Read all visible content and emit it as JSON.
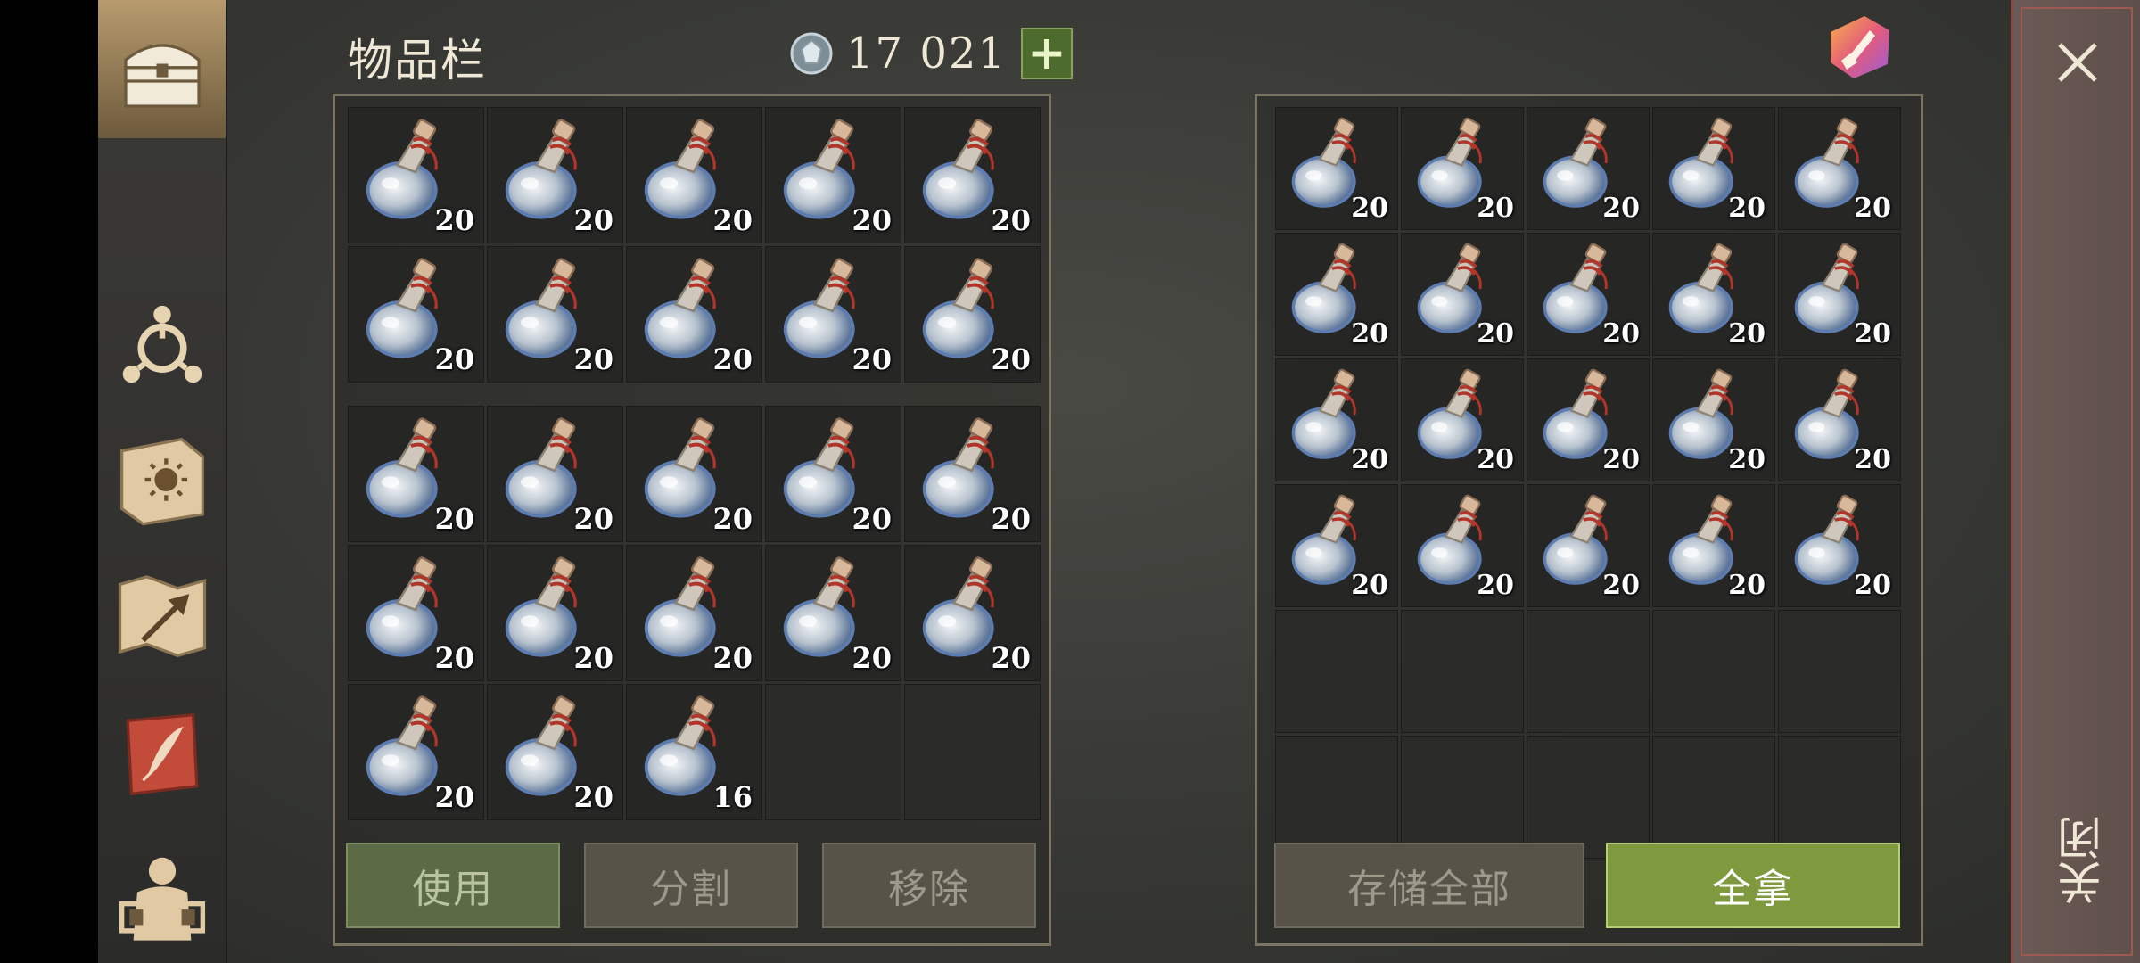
{
  "header": {
    "title": "物品栏",
    "currency_value": "17 021",
    "plus_label": "+"
  },
  "sidebar": {
    "items": [
      {
        "name": "inventory-chest-icon",
        "active": true
      },
      {
        "name": "skills-icon"
      },
      {
        "name": "journal-icon"
      },
      {
        "name": "map-build-icon"
      },
      {
        "name": "quest-scroll-icon"
      },
      {
        "name": "character-icon"
      }
    ]
  },
  "inventory": {
    "grid_top": [
      "20",
      "20",
      "20",
      "20",
      "20",
      "20",
      "20",
      "20",
      "20",
      "20"
    ],
    "grid_bottom": [
      "20",
      "20",
      "20",
      "20",
      "20",
      "20",
      "20",
      "20",
      "20",
      "20",
      "20",
      "20",
      "16",
      "",
      ""
    ]
  },
  "storage": {
    "slots": [
      "20",
      "20",
      "20",
      "20",
      "20",
      "20",
      "20",
      "20",
      "20",
      "20",
      "20",
      "20",
      "20",
      "20",
      "20",
      "20",
      "20",
      "20",
      "20",
      "20",
      "",
      "",
      "",
      "",
      "",
      "",
      "",
      "",
      "",
      ""
    ]
  },
  "buttons": {
    "use": "使用",
    "split": "分割",
    "remove": "移除",
    "store_all": "存储全部",
    "take_all": "全拿"
  },
  "close": {
    "label": "关闭"
  },
  "colors": {
    "accent_green": "#7f9a3e",
    "close_red": "#8a4a44"
  }
}
